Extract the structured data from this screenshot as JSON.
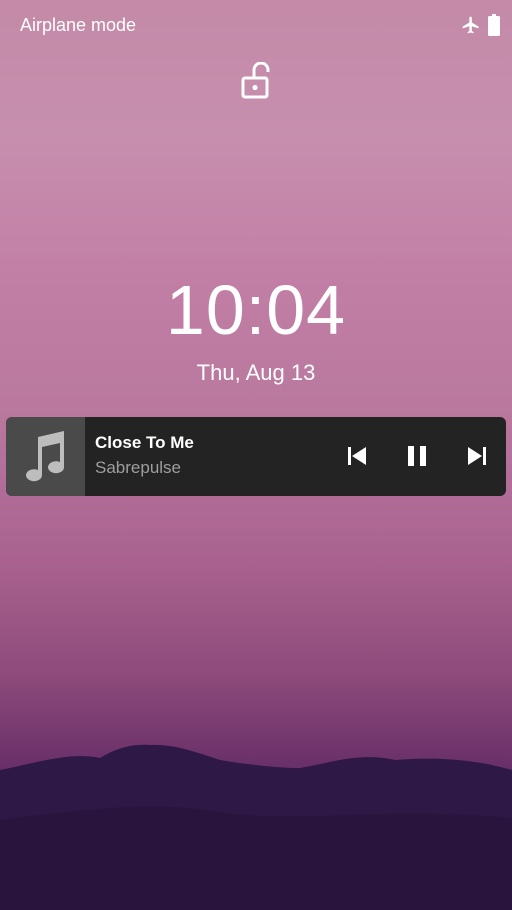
{
  "status_bar": {
    "mode_text": "Airplane mode",
    "icons": [
      "airplane-icon",
      "battery-icon"
    ]
  },
  "lock_screen": {
    "lock_icon": "lock-open-icon",
    "time": "10:04",
    "date": "Thu, Aug 13"
  },
  "media": {
    "title": "Close To Me",
    "artist": "Sabrepulse",
    "art_icon": "music-note-icon",
    "controls": [
      "previous-icon",
      "pause-icon",
      "next-icon"
    ]
  },
  "colors": {
    "card_bg": "#232323",
    "art_bg": "#4a4a4a",
    "artist_text": "#9e9e9e"
  }
}
